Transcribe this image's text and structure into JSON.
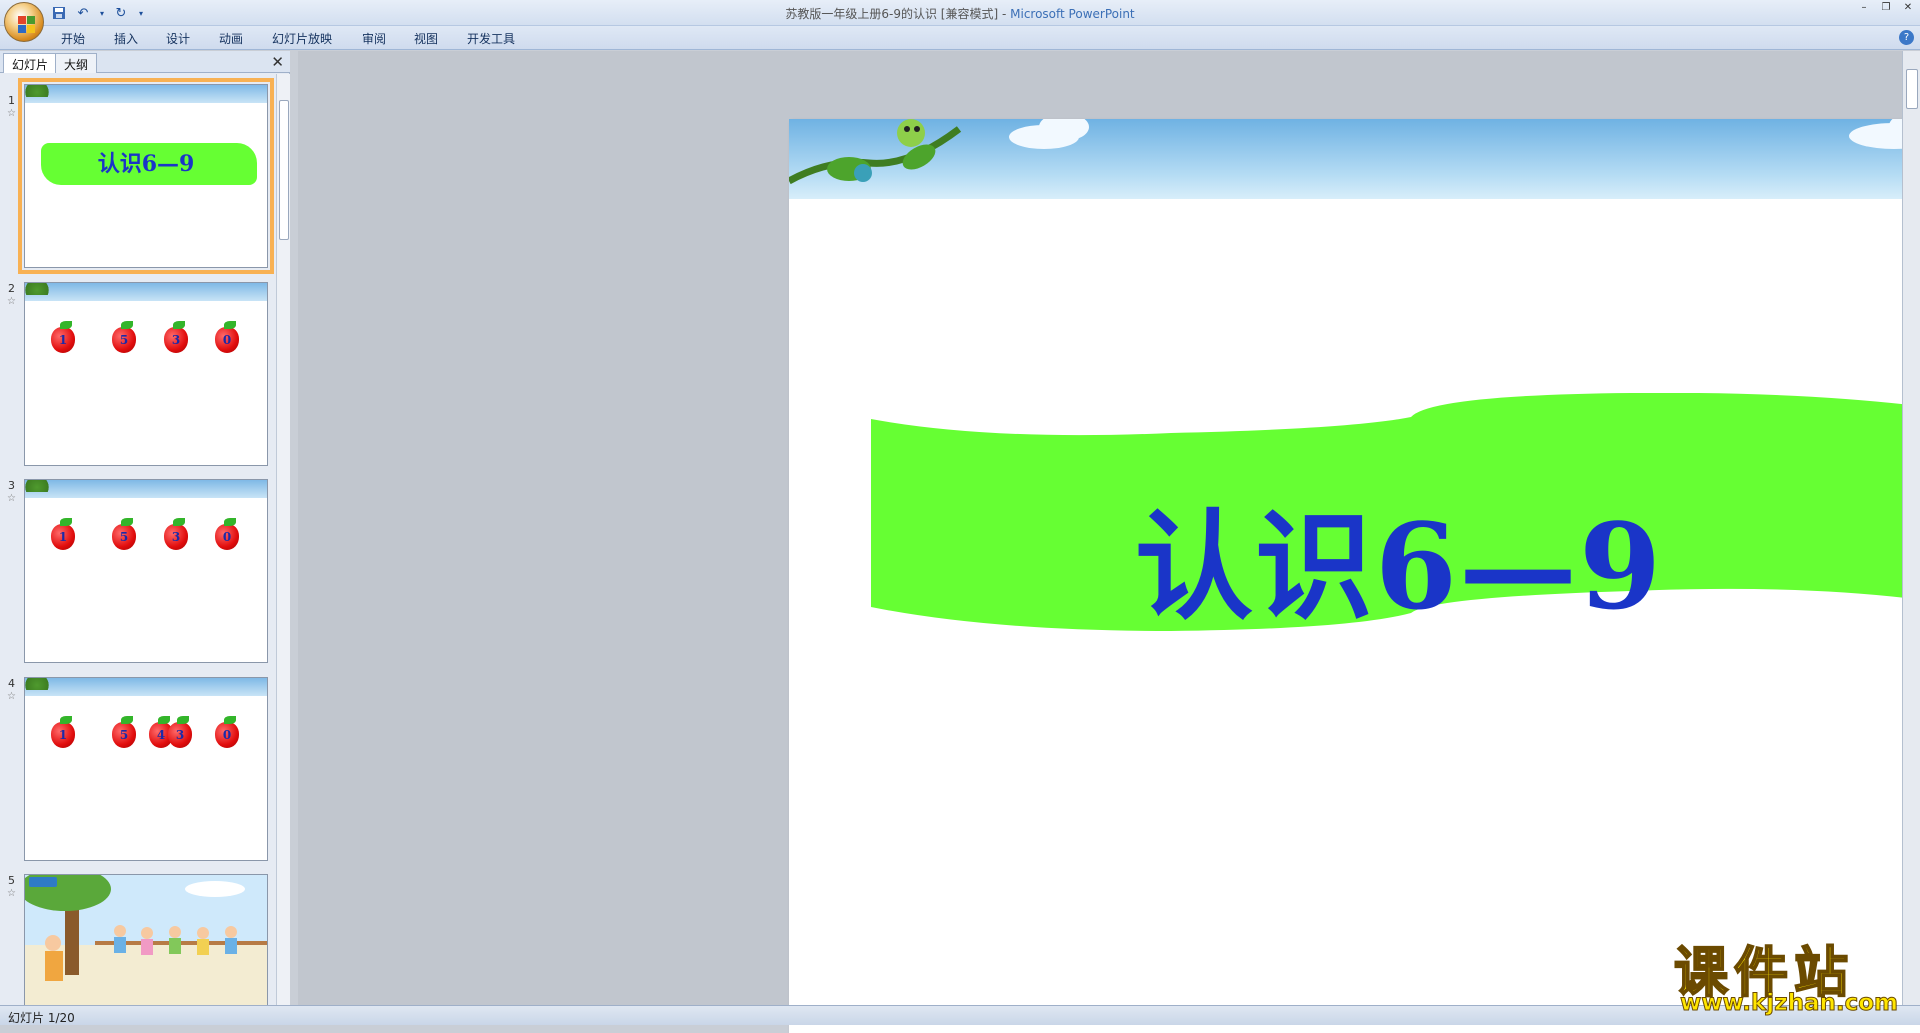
{
  "window": {
    "title_doc": "苏教版一年级上册6-9的认识 [兼容模式] - ",
    "title_app": "Microsoft PowerPoint"
  },
  "ribbon": {
    "tabs": [
      "开始",
      "插入",
      "设计",
      "动画",
      "幻灯片放映",
      "审阅",
      "视图",
      "开发工具"
    ]
  },
  "left_pane": {
    "tabs": [
      "幻灯片",
      "大纲"
    ],
    "active_tab": "幻灯片",
    "thumbnails": [
      {
        "number": "1",
        "title": "认识6—9",
        "selected": true
      },
      {
        "number": "2",
        "apples": [
          "1",
          "5",
          "3",
          "0"
        ]
      },
      {
        "number": "3",
        "apples": [
          "1",
          "5",
          "3",
          "0"
        ]
      },
      {
        "number": "4",
        "apples": [
          "1",
          "5",
          "4",
          "3",
          "0"
        ]
      },
      {
        "number": "5"
      }
    ]
  },
  "slide": {
    "title": "认识6—9",
    "banner_color": "#66ff33",
    "title_color": "#1a35c8"
  },
  "status": {
    "text": "幻灯片 1/20"
  },
  "watermark": {
    "main": "课件站",
    "url": "www.kjzhan.com"
  }
}
